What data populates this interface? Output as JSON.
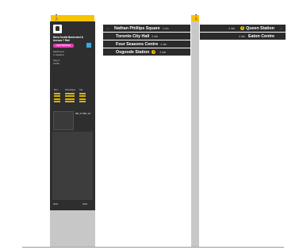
{
  "totem": {
    "walk_glyph": "🚶",
    "stop_name": "Nova Scotia Boulevard & Avenue 7 Rail",
    "pill_label": "NEW BRIDGE",
    "direction_text": "Eastbound\nto Spadina",
    "stop_number": "Stop #\n12345",
    "timetable_headers": [
      "Mon",
      "Weekdays",
      "Sat"
    ],
    "route_number": "38 | 17:55 | 14",
    "footer_left": "0000",
    "footer_right": "0000",
    "colors": {
      "accent": "#f6c400",
      "panel": "#2e2e2e",
      "pill": "#e040b0",
      "info": "#3aa8e0"
    }
  },
  "fingerpost": {
    "walk_glyph": "🚶",
    "left_blades": [
      {
        "label": "Nathan Phillips Square",
        "meta": "1 min",
        "arrow": "←"
      },
      {
        "label": "Toronto City Hall",
        "meta": "3 min"
      },
      {
        "label": "Four Seasons Centre",
        "meta": "4 min"
      },
      {
        "label": "Osgoode Station",
        "meta": "4 min",
        "badge": "1"
      }
    ],
    "right_blades": [
      {
        "label": "Queen Station",
        "meta": "4 min",
        "badge": "1",
        "arrow": "→"
      },
      {
        "label": "Eaton Centre",
        "meta": "4 min"
      }
    ]
  }
}
